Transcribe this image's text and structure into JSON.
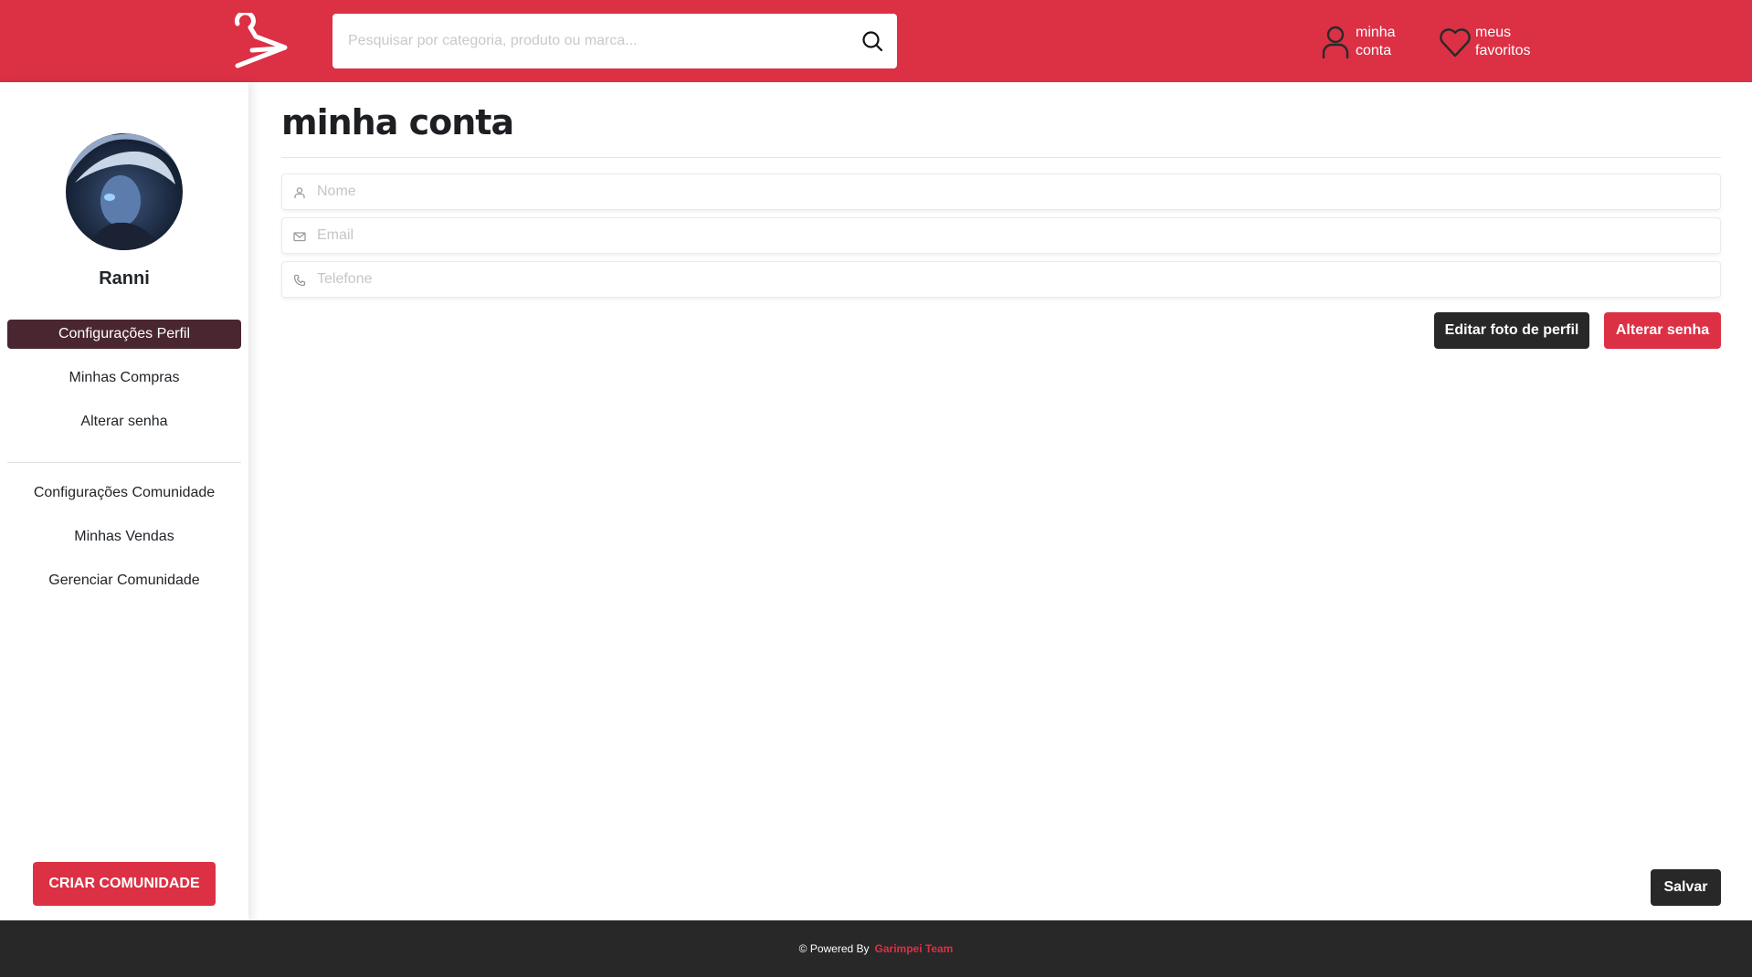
{
  "colors": {
    "primary": "#dc3045",
    "dark": "#282828",
    "active_nav": "#4a2730",
    "footer_bg": "#282828"
  },
  "header": {
    "logo_icon": "hanger-icon",
    "search": {
      "placeholder": "Pesquisar por categoria, produto ou marca...",
      "icon": "search-icon"
    },
    "account": {
      "label_line1": "minha",
      "label_line2": "conta",
      "icon": "user-icon"
    },
    "favorites": {
      "label_line1": "meus",
      "label_line2": "favoritos",
      "icon": "heart-icon"
    }
  },
  "sidebar": {
    "username": "Ranni",
    "profile_nav": [
      {
        "label": "Configurações Perfil",
        "active": true
      },
      {
        "label": "Minhas Compras",
        "active": false
      },
      {
        "label": "Alterar senha",
        "active": false
      }
    ],
    "community_nav": [
      {
        "label": "Configurações Comunidade"
      },
      {
        "label": "Minhas Vendas"
      },
      {
        "label": "Gerenciar Comunidade"
      }
    ],
    "create_button": "CRIAR COMUNIDADE"
  },
  "main": {
    "title": "minha conta",
    "fields": [
      {
        "placeholder": "Nome",
        "value": "",
        "icon": "user-icon"
      },
      {
        "placeholder": "Email",
        "value": "",
        "icon": "mail-icon"
      },
      {
        "placeholder": "Telefone",
        "value": "",
        "icon": "phone-icon"
      }
    ],
    "edit_photo_button": "Editar foto de perfil",
    "change_password_button": "Alterar senha",
    "save_button": "Salvar"
  },
  "footer": {
    "text": "© Powered By",
    "brand": "Garimpei Team"
  }
}
